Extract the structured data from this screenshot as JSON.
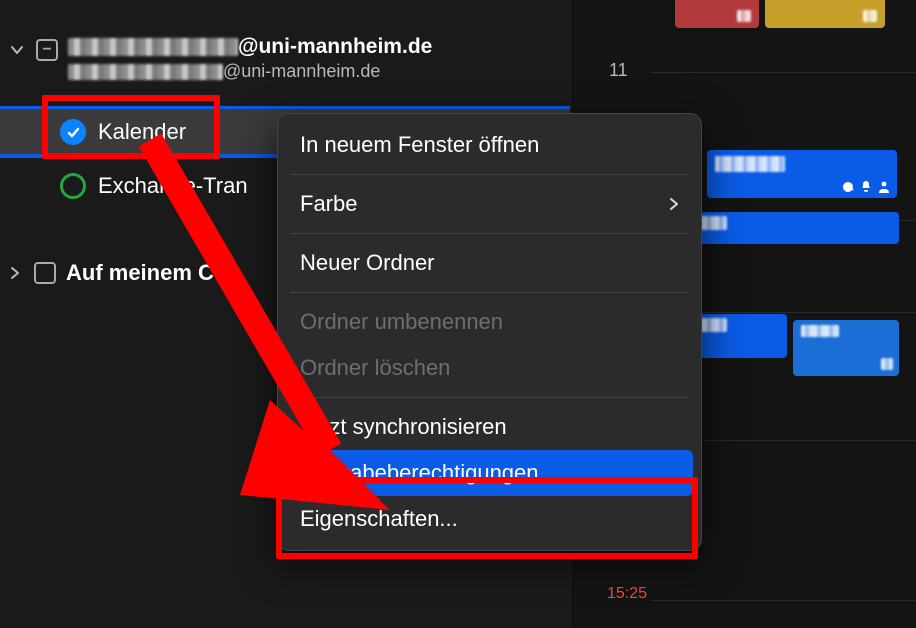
{
  "sidebar": {
    "account": {
      "domain_part": "@uni-mannheim.de",
      "sub_domain_part": "@uni-mannheim.de"
    },
    "collapse_glyph": "−",
    "items": [
      {
        "label": "Kalender",
        "checked": true,
        "color": "blue"
      },
      {
        "label": "Exchange-Tran",
        "checked": false,
        "color": "green"
      }
    ],
    "local_section": "Auf meinem Co"
  },
  "context_menu": {
    "open_new_window": "In neuem Fenster öffnen",
    "color": "Farbe",
    "new_folder": "Neuer Ordner",
    "rename_folder": "Ordner umbenennen",
    "delete_folder": "Ordner löschen",
    "sync_now": "Jetzt synchronisieren",
    "share_permissions": "Freigabeberechtigungen...",
    "properties": "Eigenschaften..."
  },
  "calendar_grid": {
    "hour_label": "11",
    "red_time": "15:25"
  }
}
